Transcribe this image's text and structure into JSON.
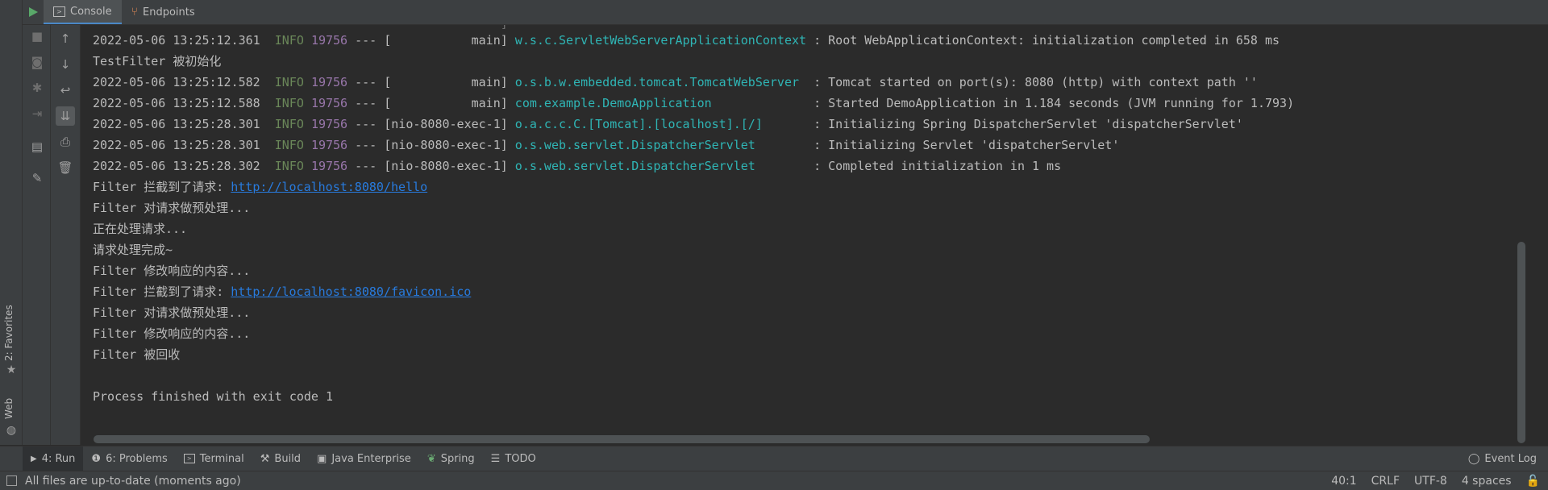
{
  "header": {
    "tabs": [
      {
        "label": "Console",
        "icon": "console-icon"
      },
      {
        "label": "Endpoints",
        "icon": "endpoints-icon"
      }
    ]
  },
  "side_tabs": {
    "favorites": "2: Favorites",
    "web": "Web"
  },
  "console": {
    "lines": [
      {
        "date": "2022-05-06 13:25:12.361",
        "level": "INFO",
        "pid": "19756",
        "sep": " --- [",
        "thread": "           main]",
        "logger": " w.s.c.ServletWebServerApplicationContext",
        "msg": " : Root WebApplicationContext: initialization completed in 658 ms"
      },
      {
        "text": "TestFilter 被初始化"
      },
      {
        "date": "2022-05-06 13:25:12.582",
        "level": "INFO",
        "pid": "19756",
        "sep": " --- [",
        "thread": "           main]",
        "logger": " o.s.b.w.embedded.tomcat.TomcatWebServer ",
        "msg": " : Tomcat started on port(s): 8080 (http) with context path ''"
      },
      {
        "date": "2022-05-06 13:25:12.588",
        "level": "INFO",
        "pid": "19756",
        "sep": " --- [",
        "thread": "           main]",
        "logger": " com.example.DemoApplication             ",
        "msg": " : Started DemoApplication in 1.184 seconds (JVM running for 1.793)"
      },
      {
        "date": "2022-05-06 13:25:28.301",
        "level": "INFO",
        "pid": "19756",
        "sep": " --- [",
        "thread": "nio-8080-exec-1]",
        "logger": " o.a.c.c.C.[Tomcat].[localhost].[/]      ",
        "msg": " : Initializing Spring DispatcherServlet 'dispatcherServlet'"
      },
      {
        "date": "2022-05-06 13:25:28.301",
        "level": "INFO",
        "pid": "19756",
        "sep": " --- [",
        "thread": "nio-8080-exec-1]",
        "logger": " o.s.web.servlet.DispatcherServlet       ",
        "msg": " : Initializing Servlet 'dispatcherServlet'"
      },
      {
        "date": "2022-05-06 13:25:28.302",
        "level": "INFO",
        "pid": "19756",
        "sep": " --- [",
        "thread": "nio-8080-exec-1]",
        "logger": " o.s.web.servlet.DispatcherServlet       ",
        "msg": " : Completed initialization in 1 ms"
      },
      {
        "text": "Filter 拦截到了请求: ",
        "link": "http://localhost:8080/hello"
      },
      {
        "text": "Filter 对请求做预处理..."
      },
      {
        "text": "正在处理请求..."
      },
      {
        "text": "请求处理完成~"
      },
      {
        "text": "Filter 修改响应的内容..."
      },
      {
        "text": "Filter 拦截到了请求: ",
        "link": "http://localhost:8080/favicon.ico"
      },
      {
        "text": "Filter 对请求做预处理..."
      },
      {
        "text": "Filter 修改响应的内容..."
      },
      {
        "text": "Filter 被回收"
      },
      {
        "text": ""
      },
      {
        "text": "Process finished with exit code 1"
      }
    ]
  },
  "bottom_tabs": [
    {
      "label": "4: Run",
      "icon": "run-icon",
      "active": true
    },
    {
      "label": "6: Problems",
      "icon": "problems-icon"
    },
    {
      "label": "Terminal",
      "icon": "terminal-icon"
    },
    {
      "label": "Build",
      "icon": "build-icon"
    },
    {
      "label": "Java Enterprise",
      "icon": "java-enterprise-icon"
    },
    {
      "label": "Spring",
      "icon": "spring-icon"
    },
    {
      "label": "TODO",
      "icon": "todo-icon"
    }
  ],
  "event_log": "Event Log",
  "status": {
    "message": "All files are up-to-date (moments ago)",
    "position": "40:1",
    "line_sep": "CRLF",
    "encoding": "UTF-8",
    "indent": "4 spaces"
  },
  "colors": {
    "accent": "#4a88c7",
    "info": "#6a8759",
    "pid": "#9876aa",
    "logger": "#2fb5b5",
    "link": "#287bde"
  }
}
